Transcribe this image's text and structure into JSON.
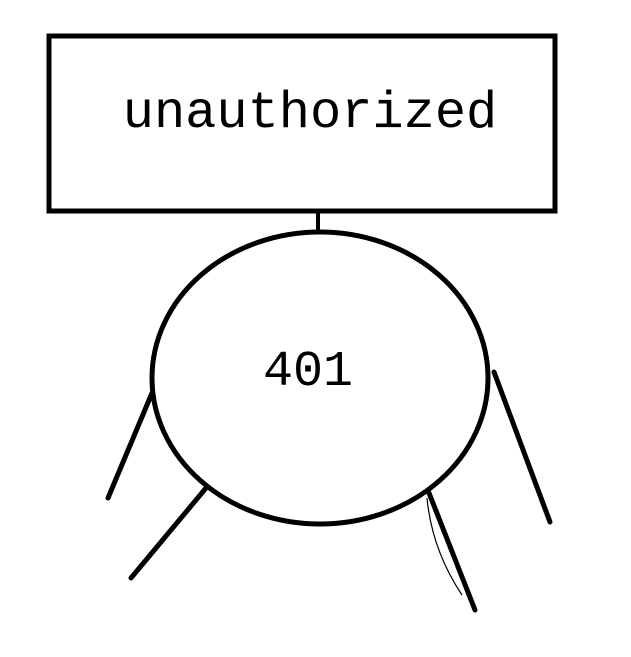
{
  "sign": {
    "text": "unauthorized"
  },
  "body": {
    "text": "401"
  },
  "colors": {
    "ink": "#000000",
    "background": "#ffffff"
  }
}
